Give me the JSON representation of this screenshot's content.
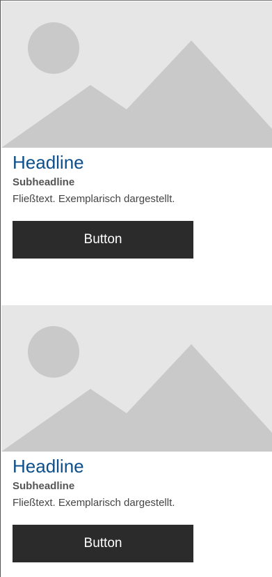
{
  "cards": [
    {
      "headline": "Headline",
      "subheadline": "Subheadline",
      "body": "Fließtext. Exemplarisch dargestellt.",
      "button_label": "Button"
    },
    {
      "headline": "Headline",
      "subheadline": "Subheadline",
      "body": "Fließtext. Exemplarisch dargestellt.",
      "button_label": "Button"
    }
  ],
  "colors": {
    "headline": "#0d4f8b",
    "button_bg": "#2b2b2b",
    "placeholder_bg": "#e6e6e6",
    "placeholder_shape": "#c9c9c9"
  },
  "icons": [
    "image-placeholder-icon"
  ]
}
